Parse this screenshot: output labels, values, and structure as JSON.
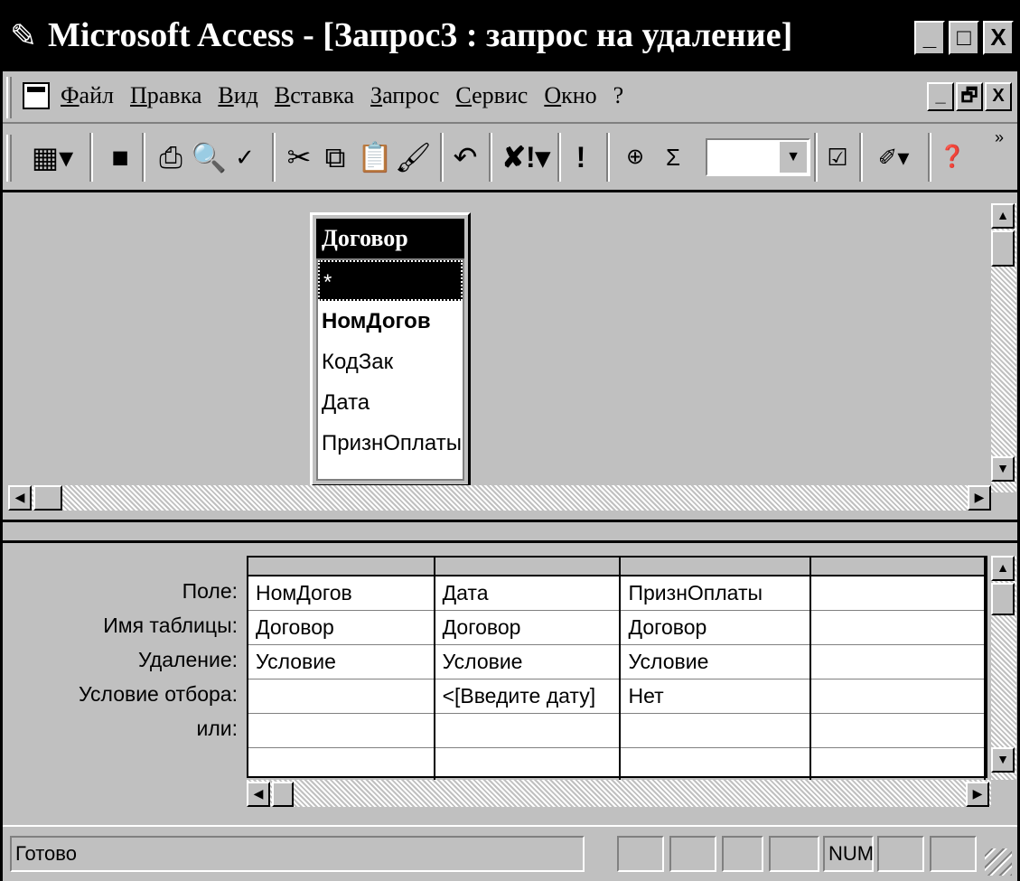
{
  "window": {
    "title": "Microsoft Access - [Запрос3 : запрос на удаление]",
    "caption_buttons": [
      "_",
      "□",
      "X"
    ]
  },
  "menubar": {
    "items": [
      "Файл",
      "Правка",
      "Вид",
      "Вставка",
      "Запрос",
      "Сервис",
      "Окно",
      "?"
    ],
    "mdi_buttons": [
      "_",
      "🗗",
      "X"
    ]
  },
  "toolbar": {
    "buttons": [
      "view-icon",
      "save-icon",
      "print-icon",
      "print-preview-icon",
      "spelling-icon",
      "cut-icon",
      "copy-icon",
      "paste-icon",
      "format-painter-icon",
      "undo-icon",
      "query-type-icon",
      "run-icon",
      "show-table-icon",
      "totals-icon",
      "properties-icon",
      "build-icon",
      "help-icon"
    ],
    "more": "»"
  },
  "field_list": {
    "title": "Договор",
    "items": [
      "*",
      "НомДогов",
      "КодЗак",
      "Дата",
      "ПризнОплаты"
    ]
  },
  "grid": {
    "row_labels": [
      "Поле:",
      "Имя таблицы:",
      "Удаление:",
      "Условие отбора:",
      "или:"
    ],
    "columns": [
      {
        "field": "НомДогов",
        "table": "Договор",
        "delete": "Условие",
        "criteria": "",
        "or": ""
      },
      {
        "field": "Дата",
        "table": "Договор",
        "delete": "Условие",
        "criteria": "<[Введите дату]",
        "or": ""
      },
      {
        "field": "ПризнОплаты",
        "table": "Договор",
        "delete": "Условие",
        "criteria": "Нет",
        "or": ""
      },
      {
        "field": "",
        "table": "",
        "delete": "",
        "criteria": "",
        "or": ""
      }
    ]
  },
  "status": {
    "text": "Готово",
    "num": "NUM"
  }
}
